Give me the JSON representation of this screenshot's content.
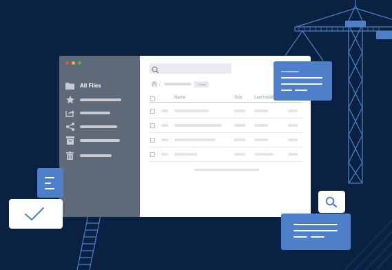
{
  "window": {
    "traffic_lights": [
      "#e8534b",
      "#f2b33d",
      "#3dbd5a"
    ],
    "sidebar": {
      "active_item_label": "All Files",
      "items": [
        {
          "icon": "folder-icon"
        },
        {
          "icon": "star-icon"
        },
        {
          "icon": "share-export-icon"
        },
        {
          "icon": "share-icon"
        },
        {
          "icon": "archive-icon"
        },
        {
          "icon": "trash-icon"
        }
      ]
    },
    "toolbar": {
      "new_button_label": "+ New"
    },
    "table": {
      "columns": [
        "Name",
        "Size",
        "Last modified"
      ]
    }
  },
  "colors": {
    "background": "#0b2142",
    "sidebar": "#5f6a79",
    "accent": "#4d80c9"
  },
  "decor": {
    "icons": [
      "crane-icon",
      "ladder-icon",
      "checkmark-icon",
      "search-icon",
      "document-icon"
    ]
  }
}
